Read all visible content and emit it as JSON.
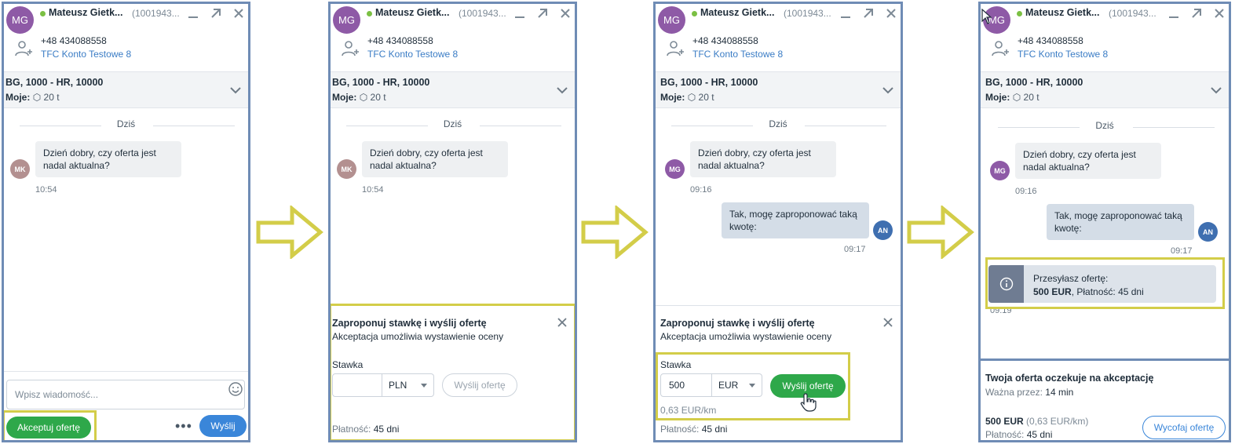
{
  "contact": {
    "initials": "MG",
    "name": "Mateusz Gietk...",
    "id_truncated": "(1001943...",
    "phone": "+48 434088558",
    "company": "TFC Konto Testowe 8"
  },
  "route": {
    "title": "BG, 1000 - HR, 10000",
    "mine_label": "Moje:",
    "mine_value": "20 t"
  },
  "chat": {
    "day_label": "Dziś",
    "incoming_line1": "Dzień dobry, czy oferta jest",
    "incoming_line2": "nadal aktualna?",
    "incoming_avatar_a": "MK",
    "incoming_avatar_b": "MG",
    "time_a": "10:54",
    "time_b": "09:16",
    "outgoing_line1": "Tak, mogę zaproponować taką",
    "outgoing_line2": "kwotę:",
    "outgoing_avatar": "AN",
    "time_out": "09:17",
    "time_sent": "09:19"
  },
  "composer": {
    "placeholder": "Wpisz wiadomość...",
    "accept_label": "Akceptuj ofertę",
    "more_label": "•••",
    "send_label": "Wyślij"
  },
  "offer_form": {
    "title": "Zaproponuj stawkę i wyślij ofertę",
    "subtitle": "Akceptacja umożliwia wystawienie oceny",
    "rate_label": "Stawka",
    "empty_value": "",
    "currency_pln": "PLN",
    "currency_eur": "EUR",
    "value": "500",
    "send_label": "Wyślij ofertę",
    "per_km": "0,63 EUR/km",
    "payment_label": "Płatność:",
    "payment_value": "45 dni"
  },
  "sent_offer": {
    "line1": "Przesyłasz ofertę:",
    "amount": "500 EUR",
    "rest": ", Płatność: 45 dni"
  },
  "awaiting": {
    "title": "Twoja oferta oczekuje na akceptację",
    "valid_label": "Ważna przez:",
    "valid_value": "14 min",
    "amount": "500 EUR",
    "per_km": "(0,63 EUR/km)",
    "payment_label": "Płatność:",
    "payment_value": "45 dni",
    "withdraw_label": "Wycofaj ofertę"
  },
  "colors": {
    "frame": "#6f8cb5",
    "highlight": "#d3cd49",
    "green": "#2ea84a",
    "blue": "#3a86d9"
  }
}
